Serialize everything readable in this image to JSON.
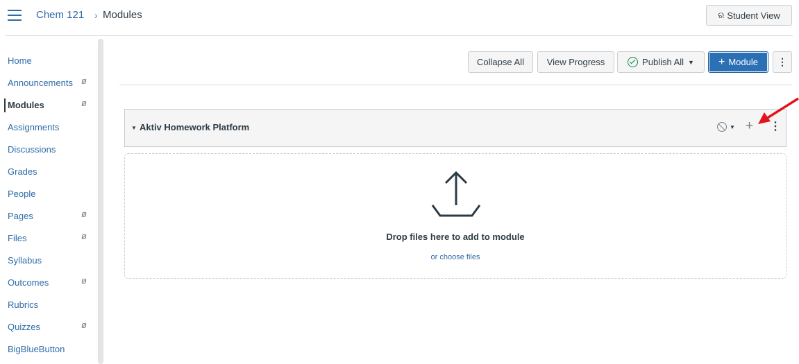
{
  "header": {
    "course_link": "Chem 121",
    "separator": "›",
    "current_page": "Modules",
    "student_view_label": "Student View"
  },
  "nav": {
    "items": [
      {
        "label": "Home",
        "hidden": false,
        "active": false
      },
      {
        "label": "Announcements",
        "hidden": true,
        "active": false
      },
      {
        "label": "Modules",
        "hidden": true,
        "active": true
      },
      {
        "label": "Assignments",
        "hidden": false,
        "active": false
      },
      {
        "label": "Discussions",
        "hidden": false,
        "active": false
      },
      {
        "label": "Grades",
        "hidden": false,
        "active": false
      },
      {
        "label": "People",
        "hidden": false,
        "active": false
      },
      {
        "label": "Pages",
        "hidden": true,
        "active": false
      },
      {
        "label": "Files",
        "hidden": true,
        "active": false
      },
      {
        "label": "Syllabus",
        "hidden": false,
        "active": false
      },
      {
        "label": "Outcomes",
        "hidden": true,
        "active": false
      },
      {
        "label": "Rubrics",
        "hidden": false,
        "active": false
      },
      {
        "label": "Quizzes",
        "hidden": true,
        "active": false
      },
      {
        "label": "BigBlueButton",
        "hidden": false,
        "active": false
      }
    ]
  },
  "toolbar": {
    "collapse_all": "Collapse All",
    "view_progress": "View Progress",
    "publish_all": "Publish All",
    "add_module_plus": "+",
    "add_module": "Module",
    "more": "⋮"
  },
  "module": {
    "caret": "▼",
    "title": "Aktiv Homework Platform",
    "publish_caret": "▼",
    "add_item": "+",
    "more": "⋮"
  },
  "drop_zone": {
    "message": "Drop files here to add to module",
    "choose_files": "or choose files"
  },
  "colors": {
    "link": "#2d6ba8",
    "primary_button": "#2b6fb5",
    "published_green": "#0b874b",
    "annotation_arrow": "#e3131b"
  },
  "icons": {
    "menu": "hamburger-icon",
    "student_view": "glasses-icon",
    "hidden_nav": "eye-off-icon",
    "publish": "check-circle-icon",
    "unpublished": "unpublished-icon",
    "upload": "upload-icon"
  }
}
